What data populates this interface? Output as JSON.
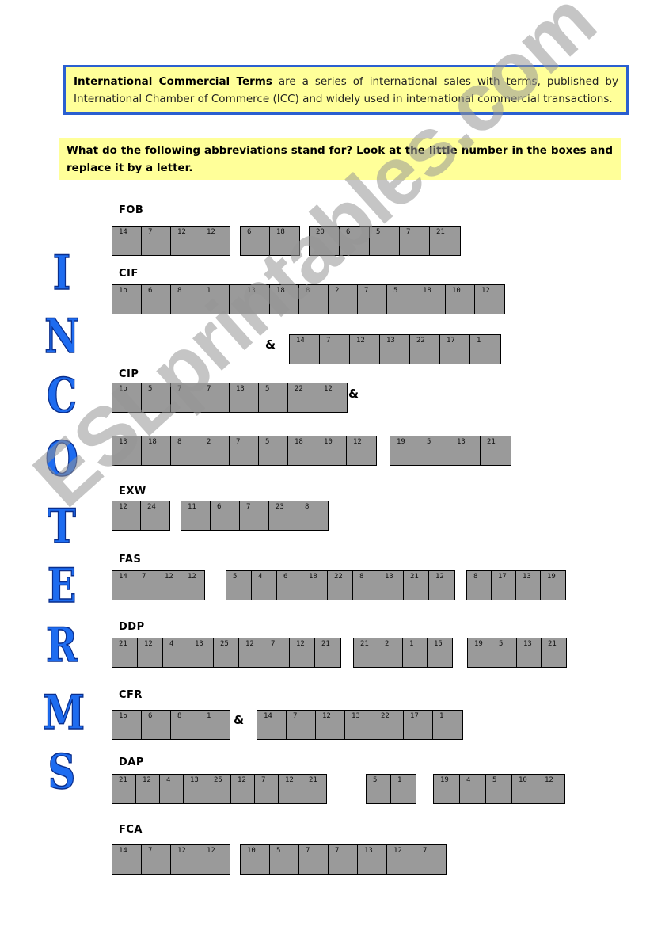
{
  "intro": {
    "bold": "International Commercial Terms",
    "rest": " are a series of international sales with terms, published by International Chamber of Commerce (ICC) and widely used in international commercial transactions."
  },
  "instruction": "What do the following abbreviations stand for? Look at the little number in the boxes and replace it by a letter.",
  "vertical_title": [
    "I",
    "N",
    "C",
    "O",
    "T",
    "E",
    "R",
    "M",
    "S"
  ],
  "watermark": "ESLprintables.com",
  "colors": {
    "title_blue": "#1e6cf0",
    "box_gray": "#9a9a9a",
    "highlight": "#ffff99",
    "border_blue": "#2a5fd0"
  },
  "terms": [
    {
      "abbr": "FOB",
      "rows": [
        [
          [
            "14",
            "7",
            "12",
            "12"
          ],
          [
            "6",
            "18"
          ],
          [
            "20",
            "6",
            "5",
            "7",
            "21"
          ]
        ]
      ]
    },
    {
      "abbr": "CIF",
      "rows": [
        [
          [
            "1o",
            "6",
            "8",
            "1",
            "",
            "13",
            "18",
            "8",
            "2",
            "7",
            "5",
            "18",
            "10",
            "12"
          ]
        ],
        [
          [
            "14",
            "7",
            "12",
            "13",
            "22",
            "17",
            "1"
          ]
        ]
      ],
      "amp": "&"
    },
    {
      "abbr": "CIP",
      "rows": [
        [
          [
            "1o",
            "5",
            "7",
            "7",
            "13",
            "5",
            "22",
            "12"
          ]
        ],
        [
          [
            "13",
            "18",
            "8",
            "2",
            "7",
            "5",
            "18",
            "10",
            "12"
          ],
          [
            "19",
            "5",
            "13",
            "21"
          ]
        ]
      ],
      "amp": "&"
    },
    {
      "abbr": "EXW",
      "rows": [
        [
          [
            "12",
            "24"
          ],
          [
            "11",
            "6",
            "7",
            "23",
            "8"
          ]
        ]
      ]
    },
    {
      "abbr": "FAS",
      "rows": [
        [
          [
            "14",
            "7",
            "12",
            "12"
          ],
          [
            "5",
            "4",
            "6",
            "18",
            "22",
            "8",
            "13",
            "21",
            "12"
          ],
          [
            "8",
            "17",
            "13",
            "19"
          ]
        ]
      ]
    },
    {
      "abbr": "DDP",
      "rows": [
        [
          [
            "21",
            "12",
            "4",
            "13",
            "25",
            "12",
            "7",
            "12",
            "21"
          ],
          [
            "21",
            "2",
            "1",
            "15"
          ],
          [
            "19",
            "5",
            "13",
            "21"
          ]
        ]
      ]
    },
    {
      "abbr": "CFR",
      "rows": [
        [
          [
            "1o",
            "6",
            "8",
            "1"
          ],
          [
            "14",
            "7",
            "12",
            "13",
            "22",
            "17",
            "1"
          ]
        ]
      ],
      "amp": "&"
    },
    {
      "abbr": "DAP",
      "rows": [
        [
          [
            "21",
            "12",
            "4",
            "13",
            "25",
            "12",
            "7",
            "12",
            "21"
          ],
          [
            "5",
            "1"
          ],
          [
            "19",
            "4",
            "5",
            "10",
            "12"
          ]
        ]
      ]
    },
    {
      "abbr": "FCA",
      "rows": [
        [
          [
            "14",
            "7",
            "12",
            "12"
          ],
          [
            "10",
            "5",
            "7",
            "7",
            "13",
            "12",
            "7"
          ]
        ]
      ]
    }
  ]
}
